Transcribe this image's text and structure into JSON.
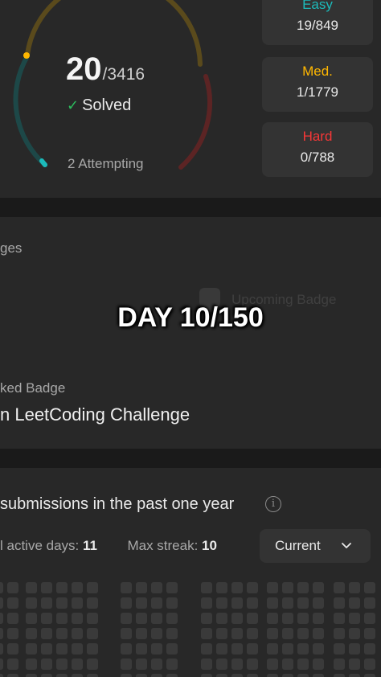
{
  "progress": {
    "solved": "20",
    "total": "/3416",
    "solved_label": "Solved",
    "attempting": "2 Attempting",
    "ring_colors": {
      "easy": "#1cbaba",
      "medium": "#ffb700",
      "hard": "#f63737"
    }
  },
  "difficulties": [
    {
      "label": "Easy",
      "value": "19/849",
      "color": "#1cbaba"
    },
    {
      "label": "Med.",
      "value": "1/1779",
      "color": "#ffb700"
    },
    {
      "label": "Hard",
      "value": "0/788",
      "color": "#f63737"
    }
  ],
  "badges": {
    "title": "ges",
    "upcoming_label": "Upcoming Badge",
    "locked_label": "ked Badge",
    "challenge_name": "n LeetCoding Challenge"
  },
  "overlay": {
    "text": "DAY 10/150"
  },
  "calendar": {
    "title": "submissions in the past one year",
    "active_label": "l active days:",
    "active_value": "11",
    "streak_label": "Max streak:",
    "streak_value": "10",
    "select_label": "Current",
    "active_color": "#2cbb5d"
  }
}
